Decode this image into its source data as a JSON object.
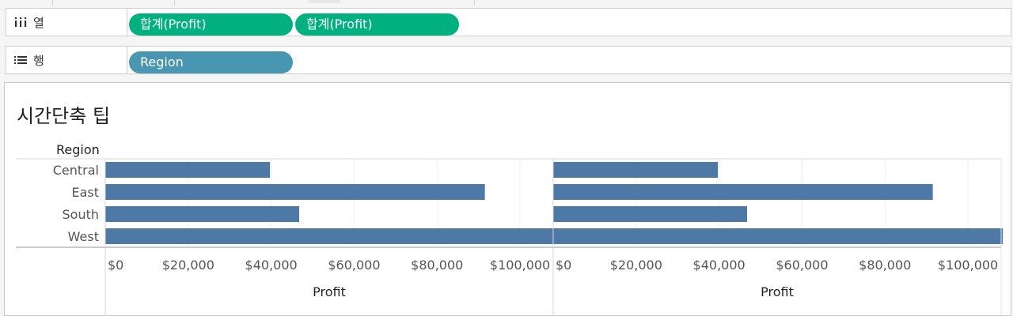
{
  "shelves": {
    "columns": {
      "label": "열",
      "icon": "columns-icon",
      "pills": [
        "합계(Profit)",
        "합계(Profit)"
      ]
    },
    "rows": {
      "label": "행",
      "icon": "rows-icon",
      "pills": [
        "Region"
      ]
    }
  },
  "colors": {
    "measure_pill": "#00b180",
    "dimension_pill": "#4996b2",
    "bar": "#4e79a7"
  },
  "chart_data": {
    "type": "bar",
    "orientation": "horizontal",
    "title": "시간단축 팁",
    "row_header": "Region",
    "categories": [
      "Central",
      "East",
      "South",
      "West"
    ],
    "panels": [
      {
        "xlabel": "Profit",
        "xlim": [
          0,
          108000
        ],
        "ticks": [
          0,
          20000,
          40000,
          60000,
          80000,
          100000
        ],
        "tick_labels": [
          "$0",
          "$20,000",
          "$40,000",
          "$60,000",
          "$80,000",
          "$100,000"
        ],
        "values": [
          39706,
          91523,
          46749,
          108418
        ]
      },
      {
        "xlabel": "Profit",
        "xlim": [
          0,
          108000
        ],
        "ticks": [
          0,
          20000,
          40000,
          60000,
          80000,
          100000
        ],
        "tick_labels": [
          "$0",
          "$20,000",
          "$40,000",
          "$60,000",
          "$80,000",
          "$100,000"
        ],
        "values": [
          39706,
          91523,
          46749,
          108418
        ]
      }
    ],
    "grid": true,
    "legend": "none"
  }
}
